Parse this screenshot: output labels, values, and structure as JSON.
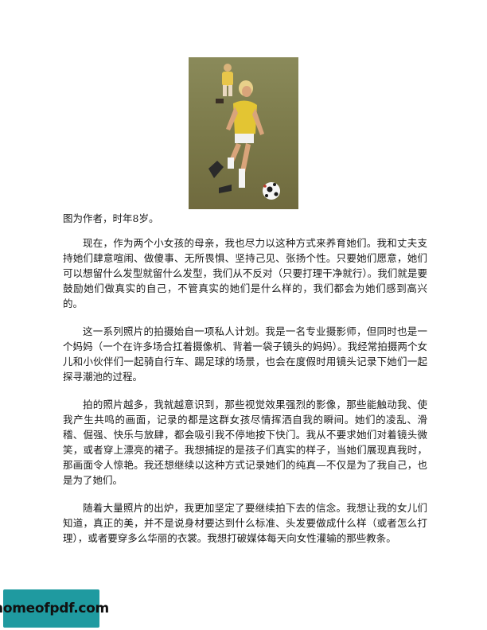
{
  "figure": {
    "caption": "图为作者，时年8岁。"
  },
  "paragraphs": [
    "现在，作为两个小女孩的母亲，我也尽力以这种方式来养育她们。我和丈夫支持她们肆意喧闹、做傻事、无所畏惧、坚持己见、张扬个性。只要她们愿意，她们可以想留什么发型就留什么发型，我们从不反对（只要打理干净就行）。我们就是要鼓励她们做真实的自己，不管真实的她们是什么样的，我们都会为她们感到高兴的。",
    "这一系列照片的拍摄始自一项私人计划。我是一名专业摄影师，但同时也是一个妈妈（一个在许多场合扛着摄像机、背着一袋子镜头的妈妈）。我经常拍摄两个女儿和小伙伴们一起骑自行车、踢足球的场景，也会在度假时用镜头记录下她们一起探寻潮池的过程。",
    "拍的照片越多，我就越意识到，那些视觉效果强烈的影像，那些能触动我、使我产生共鸣的画面，记录的都是这群女孩尽情挥洒自我的瞬间。她们的凌乱、滑稽、倔强、快乐与放肆，都会吸引我不停地按下快门。我从不要求她们对着镜头微笑，或者穿上漂亮的裙子。我想捕捉的是孩子们真实的样子，当她们展现真我时，那画面令人惊艳。我还想继续以这种方式记录她们的纯真—不仅是为了我自己，也是为了她们。",
    "随着大量照片的出炉，我更加坚定了要继续拍下去的信念。我想让我的女儿们知道，真正的美，并不是说身材要达到什么标准、头发要做成什么样（或者怎么打理），或者要穿多么华丽的衣裳。我想打破媒体每天向女性灌输的那些教条。"
  ],
  "watermark": {
    "text": "homeofpdf.com",
    "color": "#1f9aa0"
  }
}
